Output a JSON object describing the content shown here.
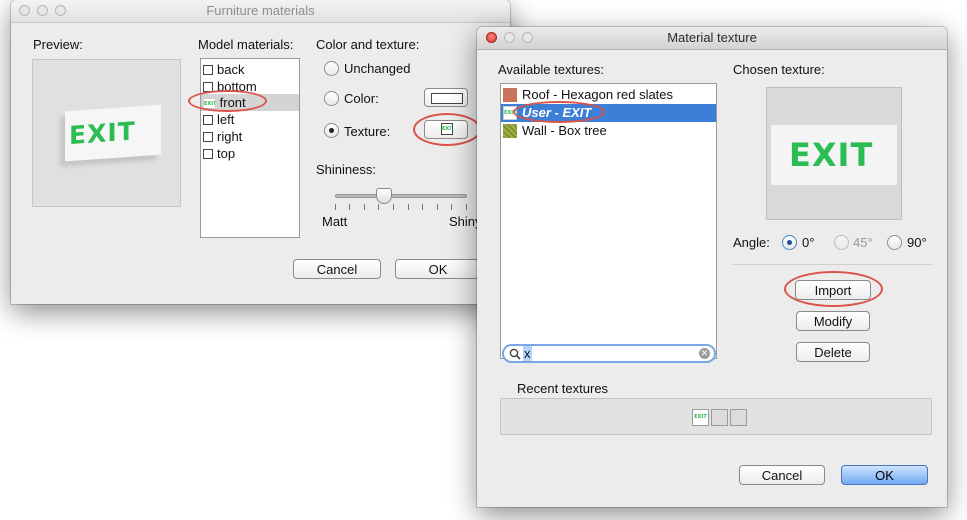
{
  "furniture_window": {
    "title": "Furniture materials",
    "preview_label": "Preview:",
    "preview_text": "EXIT",
    "model_materials_label": "Model materials:",
    "materials": [
      "back",
      "bottom",
      "front",
      "left",
      "right",
      "top"
    ],
    "selected_material": "front",
    "front_icon_text": "EXIT",
    "color_texture_label": "Color and texture:",
    "unchanged_label": "Unchanged",
    "color_label": "Color:",
    "texture_label": "Texture:",
    "texture_button_icon": "EXIT",
    "shininess_label": "Shininess:",
    "matt_label": "Matt",
    "shiny_label": "Shiny",
    "cancel_label": "Cancel",
    "ok_label": "OK",
    "shininess_value": 0.35
  },
  "texture_window": {
    "title": "Material texture",
    "available_label": "Available textures:",
    "textures": [
      {
        "label": "Roof - Hexagon red slates",
        "swatch": "#c9735a"
      },
      {
        "label": "User - EXIT",
        "swatch": "exit"
      },
      {
        "label": "Wall - Box tree",
        "swatch": "#8a9a3a"
      }
    ],
    "selected_texture": "User - EXIT",
    "search_value": "x",
    "chosen_label": "Chosen texture:",
    "chosen_preview_text": "EXIT",
    "angle_label": "Angle:",
    "angle_options": [
      "0°",
      "45°",
      "90°"
    ],
    "angle_selected": "0°",
    "import_label": "Import",
    "modify_label": "Modify",
    "delete_label": "Delete",
    "recent_label": "Recent textures",
    "recent_icon_text": "EXIT",
    "cancel_label": "Cancel",
    "ok_label": "OK"
  },
  "colors": {
    "selection": "#3d7fd6",
    "selection_inactive": "#d4d4d4",
    "exit_green": "#2bbd52",
    "annotation_red": "#d9534b"
  }
}
